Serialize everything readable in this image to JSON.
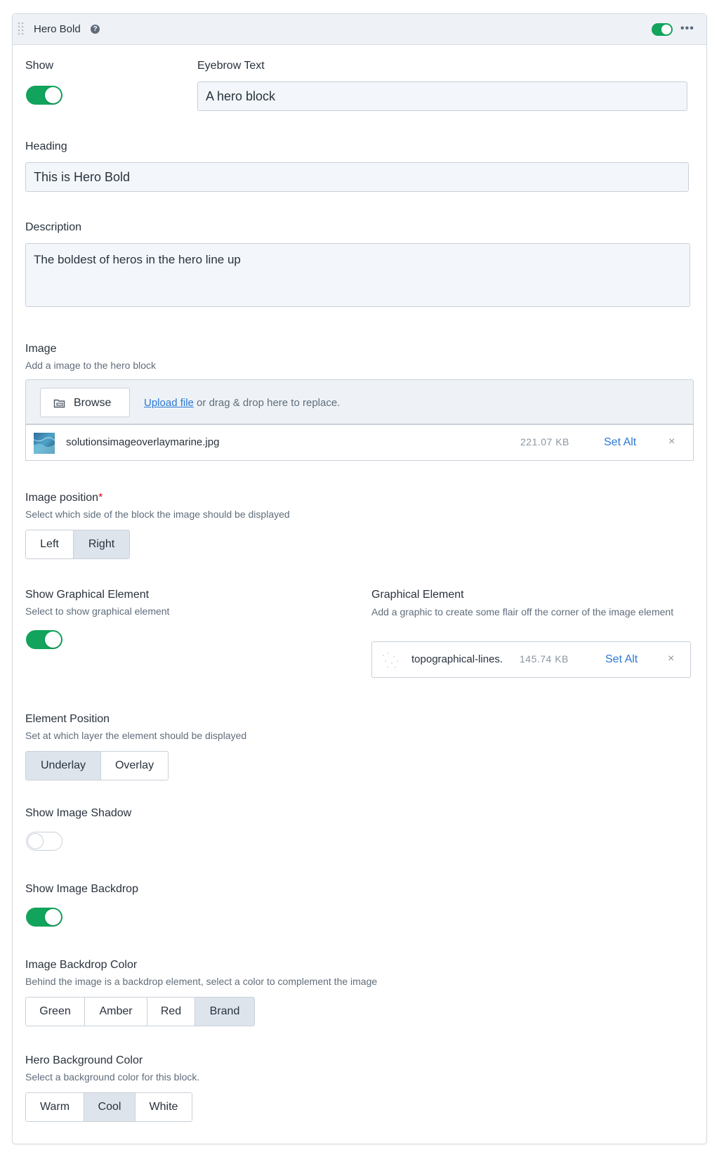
{
  "block": {
    "title": "Hero Bold",
    "enabled": true,
    "menu_label": "•••"
  },
  "fields": {
    "show": {
      "label": "Show",
      "value": true
    },
    "eyebrow": {
      "label": "Eyebrow Text",
      "value": "A hero block"
    },
    "heading": {
      "label": "Heading",
      "value": "This is Hero Bold"
    },
    "description": {
      "label": "Description",
      "value": "The boldest of heros in the hero line up"
    },
    "image": {
      "label": "Image",
      "hint": "Add a image to the hero block",
      "browse_label": "Browse",
      "upload_link": "Upload file",
      "drop_text": " or drag & drop here to replace.",
      "file": {
        "name": "solutionsimageoverlaymarine.jpg",
        "size": "221.07 KB",
        "set_alt": "Set Alt",
        "remove": "×"
      }
    },
    "image_position": {
      "label": "Image position",
      "required_mark": "*",
      "hint": "Select which side of the block the image should be displayed",
      "options": [
        "Left",
        "Right"
      ],
      "selected": "Right"
    },
    "show_graphical_element": {
      "label": "Show Graphical Element",
      "hint": "Select to show graphical element",
      "value": true
    },
    "graphical_element": {
      "label": "Graphical Element",
      "hint": "Add a graphic to create some flair off the corner of the image element",
      "file": {
        "name": "topographical-lines.",
        "size": "145.74 KB",
        "set_alt": "Set Alt",
        "remove": "×"
      }
    },
    "element_position": {
      "label": "Element Position",
      "hint": "Set at which layer the element should be displayed",
      "options": [
        "Underlay",
        "Overlay"
      ],
      "selected": "Underlay"
    },
    "show_image_shadow": {
      "label": "Show Image Shadow",
      "value": false
    },
    "show_image_backdrop": {
      "label": "Show Image Backdrop",
      "value": true
    },
    "image_backdrop_color": {
      "label": "Image Backdrop Color",
      "hint": "Behind the image is a backdrop element, select a color to complement the image",
      "options": [
        "Green",
        "Amber",
        "Red",
        "Brand"
      ],
      "selected": "Brand"
    },
    "hero_background_color": {
      "label": "Hero Background Color",
      "hint": "Select a background color for this block.",
      "options": [
        "Warm",
        "Cool",
        "White"
      ],
      "selected": "Cool"
    }
  },
  "colors": {
    "toggle_on": "#12a35c",
    "link": "#2b78d4",
    "selected_option": "#dde4ec",
    "header_bg": "#eef2f6",
    "required": "#cf1124"
  },
  "icons": {
    "drag": "drag-handle-icon",
    "info": "info-icon",
    "folder": "folder-icon",
    "menu": "more-icon",
    "remove": "close-icon"
  }
}
